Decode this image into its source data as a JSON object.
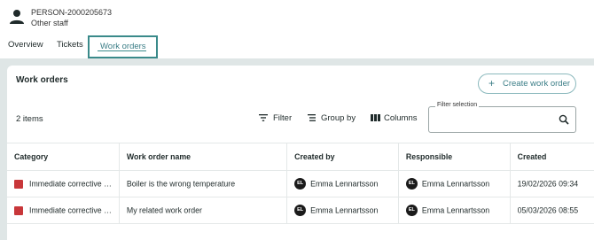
{
  "person": {
    "id": "PERSON-2000205673",
    "role": "Other staff",
    "icon": "person-icon"
  },
  "tabs": [
    {
      "label": "Overview",
      "active": false
    },
    {
      "label": "Tickets",
      "active": false
    },
    {
      "label": "Work orders",
      "active": true
    }
  ],
  "card": {
    "title": "Work orders",
    "create_button": "Create work order",
    "item_count": "2 items",
    "toolbar": {
      "filter": "Filter",
      "group_by": "Group by",
      "columns": "Columns"
    },
    "filter_selection": {
      "label": "Filter selection",
      "value": "",
      "placeholder": ""
    }
  },
  "table": {
    "headers": [
      "Category",
      "Work order name",
      "Created by",
      "Responsible",
      "Created"
    ],
    "rows": [
      {
        "category": "Immediate corrective …",
        "name": "Boiler is the wrong temperature",
        "created_by": {
          "initials": "EL",
          "name": "Emma Lennartsson"
        },
        "responsible": {
          "initials": "EL",
          "name": "Emma Lennartsson"
        },
        "created": "19/02/2026 09:34"
      },
      {
        "category": "Immediate corrective …",
        "name": "My related work order",
        "created_by": {
          "initials": "EL",
          "name": "Emma Lennartsson"
        },
        "responsible": {
          "initials": "EL",
          "name": "Emma Lennartsson"
        },
        "created": "05/03/2026 08:55"
      }
    ]
  },
  "colors": {
    "accent": "#3a8a8a",
    "category_red": "#c8373a",
    "background": "#dfe6e6"
  }
}
